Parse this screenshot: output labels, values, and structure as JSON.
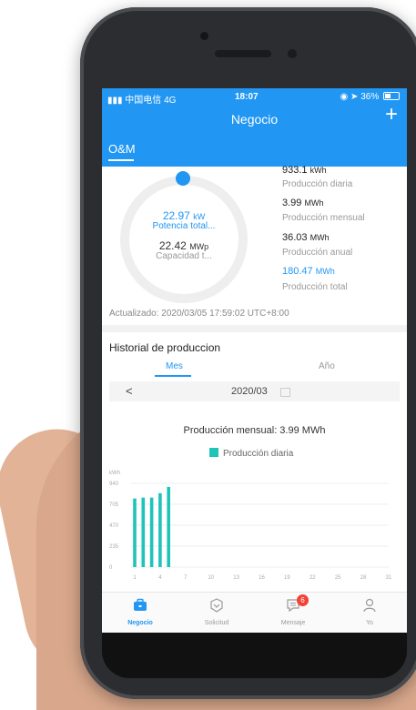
{
  "status_bar": {
    "carrier": "中国电信",
    "network": "4G",
    "time": "18:07",
    "battery": "36%"
  },
  "header": {
    "title": "Negocio",
    "add_label": "+",
    "tab": "O&M"
  },
  "overview": {
    "power_value": "22.97",
    "power_unit": "kW",
    "power_label": "Potencia total...",
    "capacity_value": "22.42",
    "capacity_unit": "MWp",
    "capacity_label": "Capacidad t...",
    "stats": [
      {
        "value": "933.1",
        "unit": "kWh",
        "label": "Producción diaria"
      },
      {
        "value": "3.99",
        "unit": "MWh",
        "label": "Producción mensual"
      },
      {
        "value": "36.03",
        "unit": "MWh",
        "label": "Producción anual"
      },
      {
        "value": "180.47",
        "unit": "MWh",
        "label": "Producción total"
      }
    ],
    "updated": "Actualizado: 2020/03/05 17:59:02 UTC+8:00"
  },
  "history": {
    "title": "Historial de produccion",
    "tab_month": "Mes",
    "tab_year": "Año",
    "prev_label": "<",
    "date": "2020/03",
    "monthly_summary": "Producción mensual: 3.99 MWh"
  },
  "chart_data": {
    "type": "bar",
    "ylabel": "kWh",
    "ylim": [
      0,
      940
    ],
    "yticks": [
      0,
      235,
      470,
      705,
      940
    ],
    "xticks": [
      1,
      4,
      7,
      10,
      13,
      16,
      19,
      22,
      25,
      28,
      31
    ],
    "series": [
      {
        "name": "Producción diaria",
        "color": "#1fc3b8",
        "x": [
          1,
          2,
          3,
          4,
          5
        ],
        "values": [
          770,
          780,
          780,
          830,
          900
        ]
      }
    ]
  },
  "nav": {
    "items": [
      {
        "label": "Negocio",
        "icon": "briefcase-icon"
      },
      {
        "label": "Solicitud",
        "icon": "shield-icon"
      },
      {
        "label": "Mensaje",
        "icon": "message-icon",
        "badge": "6"
      },
      {
        "label": "Yo",
        "icon": "user-icon"
      }
    ]
  },
  "colors": {
    "accent": "#2196f3",
    "bar": "#1fc3b8",
    "badge": "#f44336"
  }
}
